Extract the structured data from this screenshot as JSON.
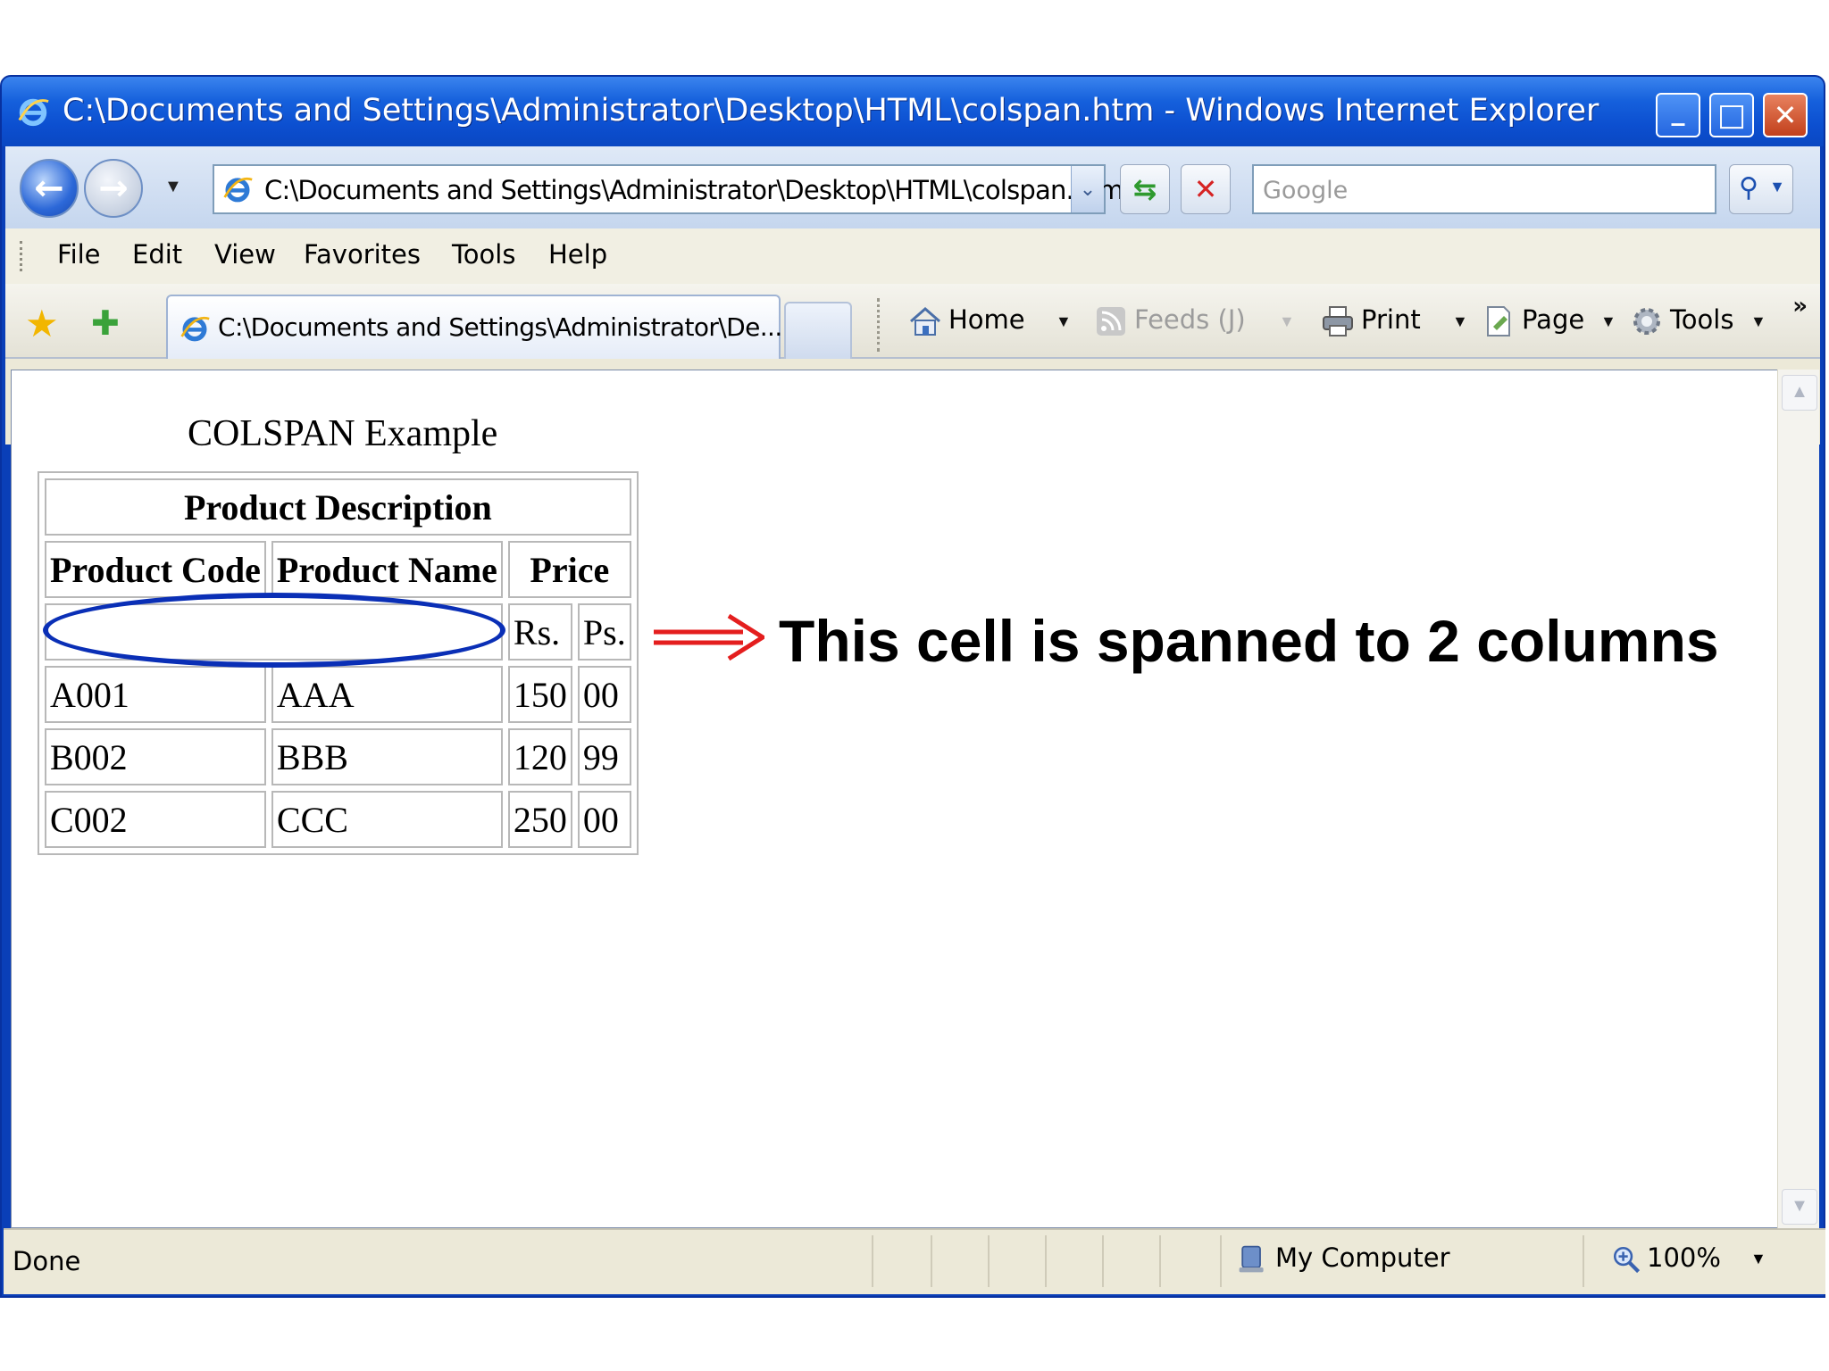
{
  "window": {
    "title": "C:\\Documents and Settings\\Administrator\\Desktop\\HTML\\colspan.htm - Windows Internet Explorer",
    "minimize_glyph": "_",
    "maximize_glyph": "□",
    "close_glyph": "✕"
  },
  "nav": {
    "back_glyph": "←",
    "forward_glyph": "→",
    "address": "C:\\Documents and Settings\\Administrator\\Desktop\\HTML\\colspan.htm",
    "search_placeholder": "Google",
    "refresh_glyph": "⇆",
    "stop_glyph": "✕"
  },
  "menu": [
    "File",
    "Edit",
    "View",
    "Favorites",
    "Tools",
    "Help"
  ],
  "tabs": {
    "active_title": "C:\\Documents and Settings\\Administrator\\De..."
  },
  "command_bar": {
    "home": "Home",
    "feeds": "Feeds (J)",
    "print": "Print",
    "page": "Page",
    "tools": "Tools"
  },
  "page": {
    "caption": "COLSPAN Example",
    "table": {
      "title": "Product Description",
      "headers": [
        "Product Code",
        "Product Name",
        "Price"
      ],
      "subheaders": [
        "Rs.",
        "Ps."
      ],
      "rows": [
        [
          "A001",
          "AAA",
          "150",
          "00"
        ],
        [
          "B002",
          "BBB",
          "120",
          "99"
        ],
        [
          "C002",
          "CCC",
          "250",
          "00"
        ]
      ]
    },
    "annotation": "This cell is spanned to 2 columns"
  },
  "status": {
    "text": "Done",
    "zone": "My Computer",
    "zoom": "100%"
  },
  "colors": {
    "title_bar": "#0c4fd0",
    "ellipse": "#0a2fb6",
    "arrow": "#e41e1e"
  }
}
